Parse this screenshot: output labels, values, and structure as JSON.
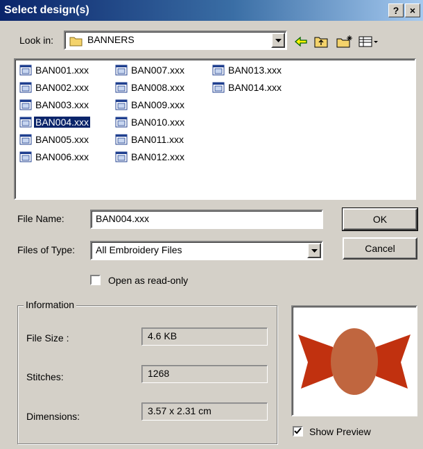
{
  "window": {
    "title": "Select design(s)",
    "help_label": "?",
    "close_label": "×"
  },
  "lookin": {
    "label": "Look in:",
    "value": "BANNERS",
    "toolbar_icons": [
      "back-arrow-icon",
      "up-folder-icon",
      "new-folder-icon",
      "view-menu-icon"
    ]
  },
  "files": [
    {
      "name": "BAN001.xxx",
      "selected": false
    },
    {
      "name": "BAN002.xxx",
      "selected": false
    },
    {
      "name": "BAN003.xxx",
      "selected": false
    },
    {
      "name": "BAN004.xxx",
      "selected": true
    },
    {
      "name": "BAN005.xxx",
      "selected": false
    },
    {
      "name": "BAN006.xxx",
      "selected": false
    },
    {
      "name": "BAN007.xxx",
      "selected": false
    },
    {
      "name": "BAN008.xxx",
      "selected": false
    },
    {
      "name": "BAN009.xxx",
      "selected": false
    },
    {
      "name": "BAN010.xxx",
      "selected": false
    },
    {
      "name": "BAN011.xxx",
      "selected": false
    },
    {
      "name": "BAN012.xxx",
      "selected": false
    },
    {
      "name": "BAN013.xxx",
      "selected": false
    },
    {
      "name": "BAN014.xxx",
      "selected": false
    }
  ],
  "filename": {
    "label": "File Name:",
    "value": "BAN004.xxx"
  },
  "filetype": {
    "label": "Files of Type:",
    "value": "All Embroidery Files"
  },
  "buttons": {
    "ok": "OK",
    "cancel": "Cancel"
  },
  "readonly": {
    "label": "Open as read-only",
    "checked": false
  },
  "info": {
    "title": "Information",
    "file_size_label": "File Size :",
    "file_size_value": "4.6 KB",
    "stitches_label": "Stitches:",
    "stitches_value": "1268",
    "dimensions_label": "Dimensions:",
    "dimensions_value": "3.57 x 2.31 cm"
  },
  "preview": {
    "show_label": "Show Preview",
    "checked": true,
    "colors": {
      "wings": "#c1310f",
      "body": "#c0663f"
    }
  }
}
